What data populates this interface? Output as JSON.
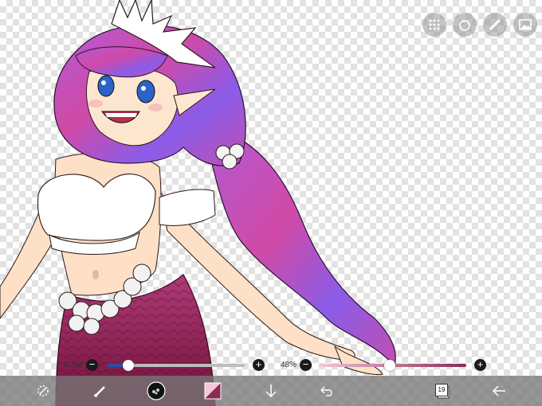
{
  "status_bar": {
    "left": "",
    "right": ""
  },
  "top_tools": [
    "layers-icon",
    "fill-icon",
    "ruler-icon",
    "gallery-icon"
  ],
  "brush_size": {
    "label": "6.2px",
    "level": 0.15
  },
  "brush_opacity": {
    "label": "48%",
    "level": 0.48
  },
  "bottom_toolbar": {
    "items": [
      "selection-icon",
      "brush-icon",
      "brush-preview",
      "color-swatch",
      "down-arrow-icon",
      "undo-icon",
      "layers-count",
      "back-icon"
    ],
    "layers_count": "19"
  },
  "colors": {
    "toolbar": "#7a7a7a",
    "accent": "#2a4ea8",
    "hair_purple": "#9c4fd0",
    "hair_pink": "#d048a0",
    "tail": "#8a1f50",
    "swatch_a": "#f2c7d6",
    "swatch_b": "#8a2a55"
  }
}
